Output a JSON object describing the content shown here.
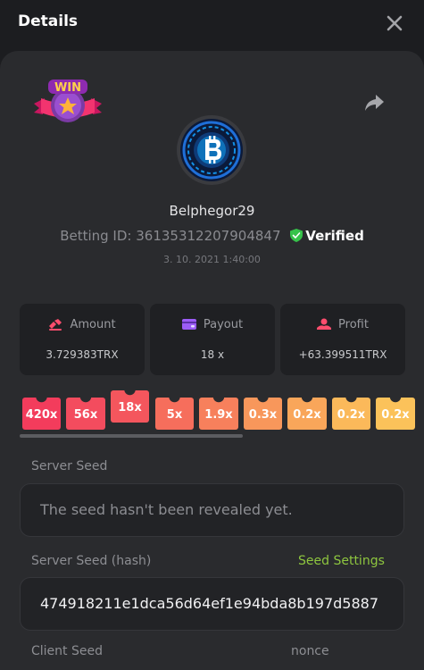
{
  "header": {
    "title": "Details"
  },
  "badge": {
    "text": "WIN"
  },
  "user": {
    "name": "Belphegor29",
    "betting_label": "Betting ID:",
    "betting_id": "36135312207904847",
    "verified_text": "Verified",
    "date": "3. 10. 2021 1:40:00"
  },
  "stats": {
    "amount": {
      "label": "Amount",
      "value": "3.729383TRX"
    },
    "payout": {
      "label": "Payout",
      "value": "18 x"
    },
    "profit": {
      "label": "Profit",
      "value": "+63.399511TRX"
    }
  },
  "multipliers": [
    {
      "label": "420x",
      "color": "#f33c5c"
    },
    {
      "label": "56x",
      "color": "#f34c5e"
    },
    {
      "label": "18x",
      "color": "#f4565d"
    },
    {
      "label": "5x",
      "color": "#f66e5c"
    },
    {
      "label": "1.9x",
      "color": "#f7805c"
    },
    {
      "label": "0.3x",
      "color": "#f8975b"
    },
    {
      "label": "0.2x",
      "color": "#f9a65a"
    },
    {
      "label": "0.2x",
      "color": "#fbb95a"
    },
    {
      "label": "0.2x",
      "color": "#fbc25a"
    }
  ],
  "seeds": {
    "server_seed_label": "Server Seed",
    "server_seed_value": "The seed hasn't been revealed yet.",
    "server_hash_label": "Server Seed (hash)",
    "seed_settings_link": "Seed Settings",
    "server_hash_value": "474918211e1dca56d64ef1e94bda8b197d5887",
    "client_seed_label": "Client Seed",
    "nonce_label": "nonce"
  },
  "colors": {
    "background": "#1c1d20",
    "panel": "#2a2b2e",
    "card": "#1f2023",
    "accent_green": "#8ec63f",
    "verified_green": "#36c24a"
  }
}
